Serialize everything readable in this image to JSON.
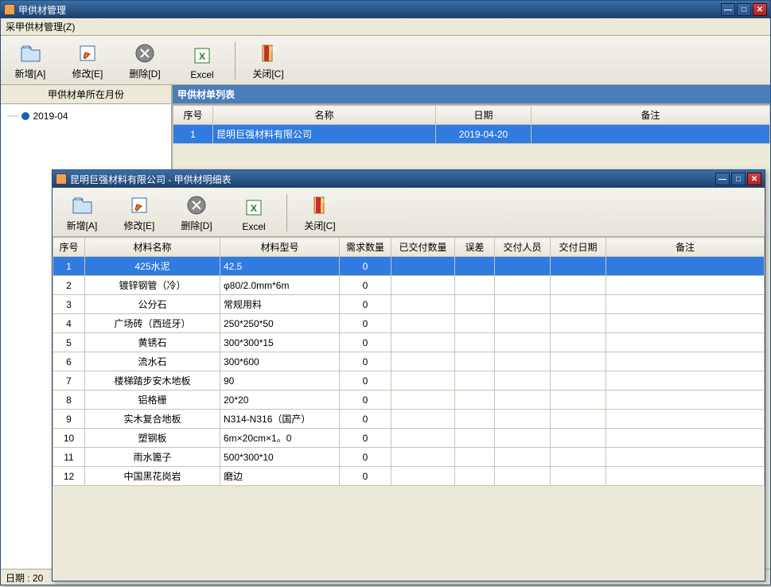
{
  "main_window": {
    "title": "甲供材管理",
    "menu": "采甲供材管理(Z)",
    "status": "日期 : 20"
  },
  "toolbar": {
    "add": "新增[A]",
    "edit": "修改[E]",
    "delete": "删除[D]",
    "excel": "Excel",
    "close": "关闭[C]"
  },
  "left_panel": {
    "header": "甲供材单所在月份",
    "tree_item": "2019-04"
  },
  "list_panel": {
    "header": "甲供材单列表",
    "cols": {
      "seq": "序号",
      "name": "名称",
      "date": "日期",
      "remark": "备注"
    },
    "rows": [
      {
        "seq": "1",
        "name": "昆明巨强材料有限公司",
        "date": "2019-04-20",
        "remark": ""
      }
    ]
  },
  "detail_window": {
    "title": "昆明巨强材料有限公司 - 甲供材明细表"
  },
  "detail_cols": {
    "seq": "序号",
    "matname": "材料名称",
    "model": "材料型号",
    "req": "需求数量",
    "delivered": "已交付数量",
    "err": "误差",
    "person": "交付人员",
    "ddate": "交付日期",
    "remark": "备注"
  },
  "detail_rows": [
    {
      "seq": "1",
      "name": "425水泥",
      "model": "42.5",
      "req": "0"
    },
    {
      "seq": "2",
      "name": "镀锌钢管（冷）",
      "model": "φ80/2.0mm*6m",
      "req": "0"
    },
    {
      "seq": "3",
      "name": "公分石",
      "model": "常规用料",
      "req": "0"
    },
    {
      "seq": "4",
      "name": "广场砖（西班牙）",
      "model": "250*250*50",
      "req": "0"
    },
    {
      "seq": "5",
      "name": "黄锈石",
      "model": "300*300*15",
      "req": "0"
    },
    {
      "seq": "6",
      "name": "流水石",
      "model": "300*600",
      "req": "0"
    },
    {
      "seq": "7",
      "name": "楼梯踏步安木地板",
      "model": "90",
      "req": "0"
    },
    {
      "seq": "8",
      "name": "铝格栅",
      "model": "20*20",
      "req": "0"
    },
    {
      "seq": "9",
      "name": "实木复合地板",
      "model": "N314-N316（国产）",
      "req": "0"
    },
    {
      "seq": "10",
      "name": "塑钢板",
      "model": "6m×20cm×1。0",
      "req": "0"
    },
    {
      "seq": "11",
      "name": "雨水篦子",
      "model": "500*300*10",
      "req": "0"
    },
    {
      "seq": "12",
      "name": "中国黑花岗岩",
      "model": "磨边",
      "req": "0"
    }
  ]
}
